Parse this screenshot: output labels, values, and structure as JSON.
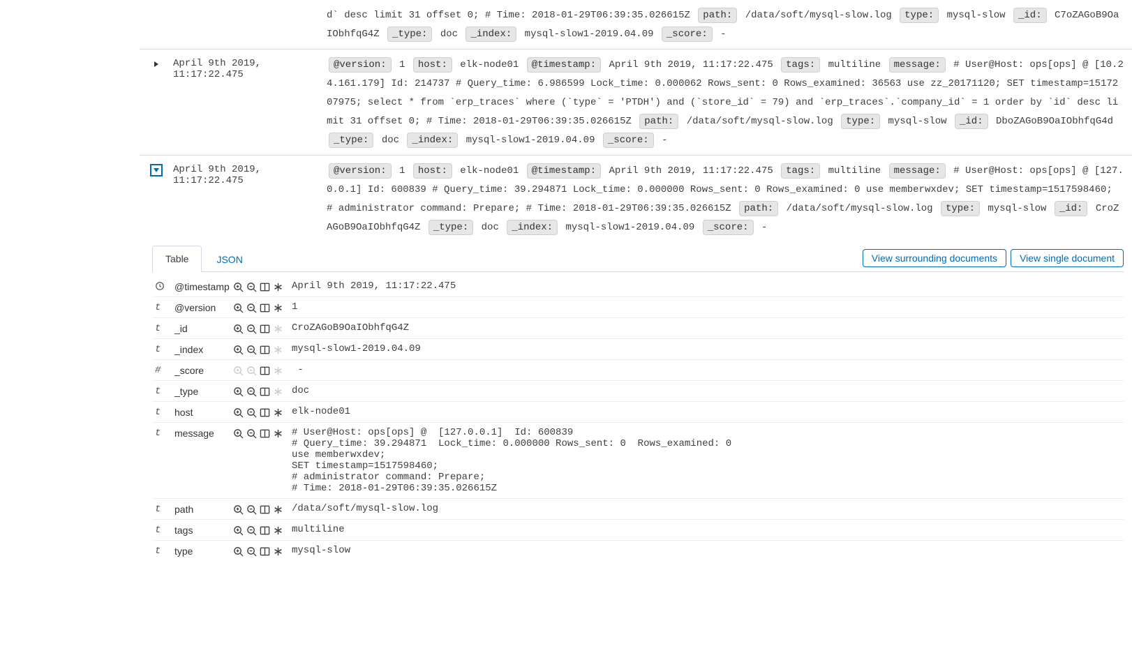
{
  "rows": [
    {
      "expanded": false,
      "time": "",
      "source": "d` desc limit 31 offset 0; # Time: 2018-01-29T06:39:35.026615Z |path:| /data/soft/mysql-slow.log |type:| mysql-slow |_id:| C7oZAGoB9OaIObhfqG4Z |_type:| doc |_index:| mysql-slow1-2019.04.09 |_score:|  -"
    },
    {
      "expanded": false,
      "time": "April 9th 2019, 11:17:22.475",
      "source": "|@version:| 1 |host:| elk-node01 |@timestamp:| April 9th 2019, 11:17:22.475 |tags:| multiline |message:| # User@Host: ops[ops] @ [10.24.161.179] Id: 214737 # Query_time: 6.986599 Lock_time: 0.000062 Rows_sent: 0 Rows_examined: 36563 use zz_20171120; SET timestamp=1517207975; select * from `erp_traces` where (`type` = 'PTDH') and (`store_id` = 79) and `erp_traces`.`company_id` = 1 order by `id` desc limit 31 offset 0; # Time: 2018-01-29T06:39:35.026615Z |path:| /data/soft/mysql-slow.log |type:| mysql-slow |_id:| DboZAGoB9OaIObhfqG4d |_type:| doc |_index:| mysql-slow1-2019.04.09 |_score:|  -"
    },
    {
      "expanded": true,
      "time": "April 9th 2019, 11:17:22.475",
      "source": "|@version:| 1 |host:| elk-node01 |@timestamp:| April 9th 2019, 11:17:22.475 |tags:| multiline |message:| # User@Host: ops[ops] @ [127.0.0.1] Id: 600839 # Query_time: 39.294871 Lock_time: 0.000000 Rows_sent: 0 Rows_examined: 0 use memberwxdev; SET timestamp=1517598460; # administrator command: Prepare; # Time: 2018-01-29T06:39:35.026615Z |path:| /data/soft/mysql-slow.log |type:| mysql-slow |_id:| CroZAGoB9OaIObhfqG4Z |_type:| doc |_index:| mysql-slow1-2019.04.09 |_score:|  -"
    }
  ],
  "detail": {
    "tabs": {
      "table": "Table",
      "json": "JSON"
    },
    "buttons": {
      "surrounding": "View surrounding documents",
      "single": "View single document"
    },
    "fields": [
      {
        "type": "clock",
        "name": "@timestamp",
        "value": "April 9th 2019, 11:17:22.475",
        "disabled": []
      },
      {
        "type": "t",
        "name": "@version",
        "value": "1",
        "disabled": []
      },
      {
        "type": "t",
        "name": "_id",
        "value": "CroZAGoB9OaIObhfqG4Z",
        "disabled": [
          "asterisk"
        ]
      },
      {
        "type": "t",
        "name": "_index",
        "value": "mysql-slow1-2019.04.09",
        "disabled": [
          "asterisk"
        ]
      },
      {
        "type": "#",
        "name": "_score",
        "value": " -",
        "disabled": [
          "zoomin",
          "zoomout",
          "asterisk"
        ]
      },
      {
        "type": "t",
        "name": "_type",
        "value": "doc",
        "disabled": [
          "asterisk"
        ]
      },
      {
        "type": "t",
        "name": "host",
        "value": "elk-node01",
        "disabled": []
      },
      {
        "type": "t",
        "name": "message",
        "value": "# User@Host: ops[ops] @  [127.0.0.1]  Id: 600839\n# Query_time: 39.294871  Lock_time: 0.000000 Rows_sent: 0  Rows_examined: 0\nuse memberwxdev;\nSET timestamp=1517598460;\n# administrator command: Prepare;\n# Time: 2018-01-29T06:39:35.026615Z",
        "disabled": []
      },
      {
        "type": "t",
        "name": "path",
        "value": "/data/soft/mysql-slow.log",
        "disabled": []
      },
      {
        "type": "t",
        "name": "tags",
        "value": "multiline",
        "disabled": []
      },
      {
        "type": "t",
        "name": "type",
        "value": "mysql-slow",
        "disabled": []
      }
    ]
  }
}
